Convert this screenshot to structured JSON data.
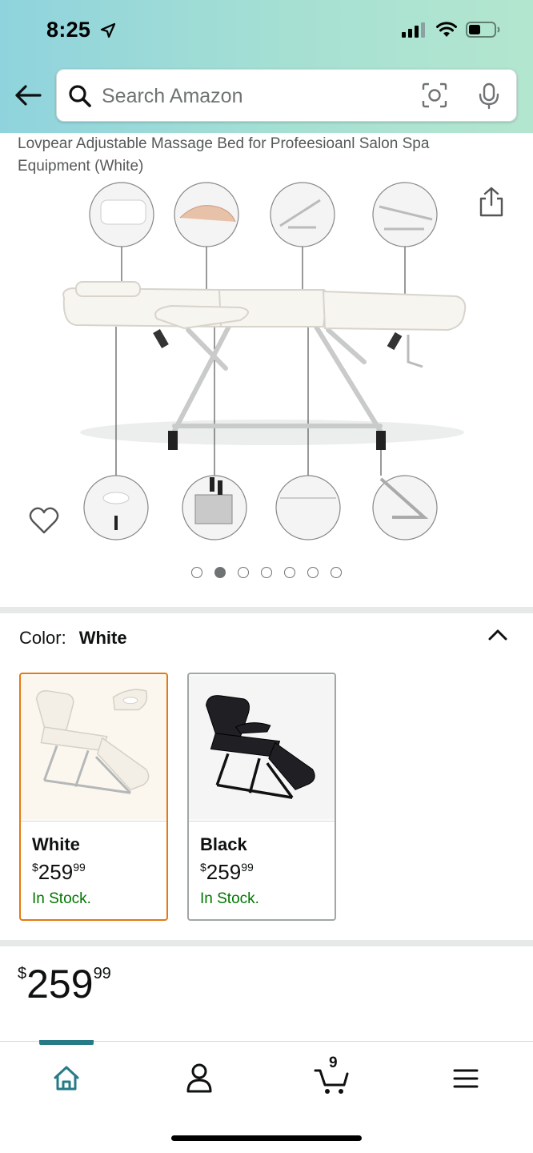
{
  "status_bar": {
    "time": "8:25"
  },
  "search": {
    "placeholder": "Search Amazon",
    "value": ""
  },
  "product": {
    "title": "Lovpear Adjustable Massage Bed for Profeesioanl Salon Spa Equipment (White)"
  },
  "gallery": {
    "image_count": 7,
    "active_index": 1
  },
  "color_selector": {
    "label": "Color:",
    "selected": "White",
    "options": [
      {
        "name": "White",
        "price_symbol": "$",
        "price_whole": "259",
        "price_fraction": "99",
        "stock": "In Stock."
      },
      {
        "name": "Black",
        "price_symbol": "$",
        "price_whole": "259",
        "price_fraction": "99",
        "stock": "In Stock."
      }
    ]
  },
  "price": {
    "symbol": "$",
    "whole": "259",
    "fraction": "99"
  },
  "bottom_nav": {
    "cart_count": "9"
  },
  "colors": {
    "header_gradient_start": "#8fd3dd",
    "header_gradient_end": "#b3e6cf",
    "selected_border": "#e47911",
    "in_stock": "#007600",
    "nav_accent": "#267b87"
  }
}
